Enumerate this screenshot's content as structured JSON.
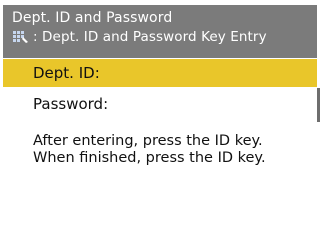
{
  "header": {
    "title": "Dept. ID and Password",
    "subtitle": ": Dept. ID and Password Key Entry",
    "icon": "key-entry-icon"
  },
  "fields": {
    "dept_id_label": "Dept. ID:",
    "password_label": "Password:"
  },
  "message": {
    "text": "After entering, press the ID key. When finished, press the ID key."
  },
  "colors": {
    "header_background": "#7b7b7b",
    "selected_field": "#e9c62a",
    "text": "#111111"
  }
}
